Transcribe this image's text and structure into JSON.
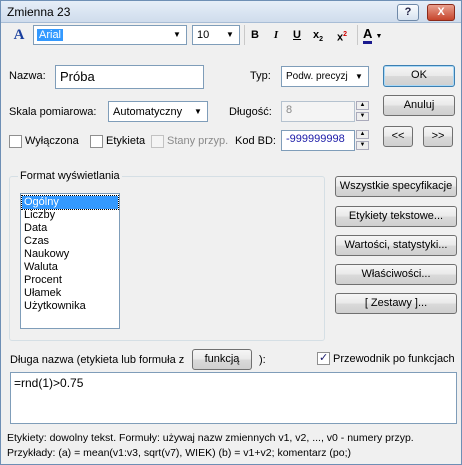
{
  "window": {
    "title": "Zmienna 23",
    "help_label": "?",
    "close_label": "X"
  },
  "toolbar": {
    "font_icon": "A",
    "font_name": "Arial",
    "font_size": "10",
    "bold": "B",
    "italic": "I",
    "underline": "U",
    "subscript": "x",
    "subscript_mark": "2",
    "superscript": "x",
    "superscript_mark": "2",
    "color": "A"
  },
  "form": {
    "name_label": "Nazwa:",
    "name_value": "Próba",
    "type_label": "Typ:",
    "type_value": "Podw. precyzj",
    "ok_label": "OK",
    "scale_label": "Skala pomiarowa:",
    "scale_value": "Automatyczny",
    "length_label": "Długość:",
    "length_value": "8",
    "cancel_label": "Anuluj",
    "disabled_label": "Wyłączona",
    "label_label": "Etykieta",
    "states_label": "Stany przyp.",
    "md_code_label": "Kod BD:",
    "md_code_value": "-999999998",
    "prev_label": "<<",
    "next_label": ">>"
  },
  "format": {
    "group_label": "Format wyświetlania",
    "items": [
      "Ogólny",
      "Liczby",
      "Data",
      "Czas",
      "Naukowy",
      "Waluta",
      "Procent",
      "Ułamek",
      "Użytkownika"
    ],
    "selected": "Ogólny"
  },
  "side_buttons": [
    "Wszystkie specyfikacje",
    "Etykiety tekstowe...",
    "Wartości, statystyki...",
    "Właściwości...",
    "[ Zestawy ]..."
  ],
  "long_name": {
    "label": "Długa nazwa (etykieta lub formuła z",
    "functions_button": "funkcją",
    "label_end": "):",
    "wizard_label": "Przewodnik po funkcjach",
    "value": "=rnd(1)>0.75"
  },
  "help": {
    "line1": "Etykiety: dowolny tekst. Formuły: używaj nazw zmiennych v1, v2, ..., v0 - numery przyp.",
    "line2": "Przykłady:   (a) = mean(v1:v3, sqrt(v7), WIEK)   (b) = v1+v2; komentarz (po;)"
  }
}
